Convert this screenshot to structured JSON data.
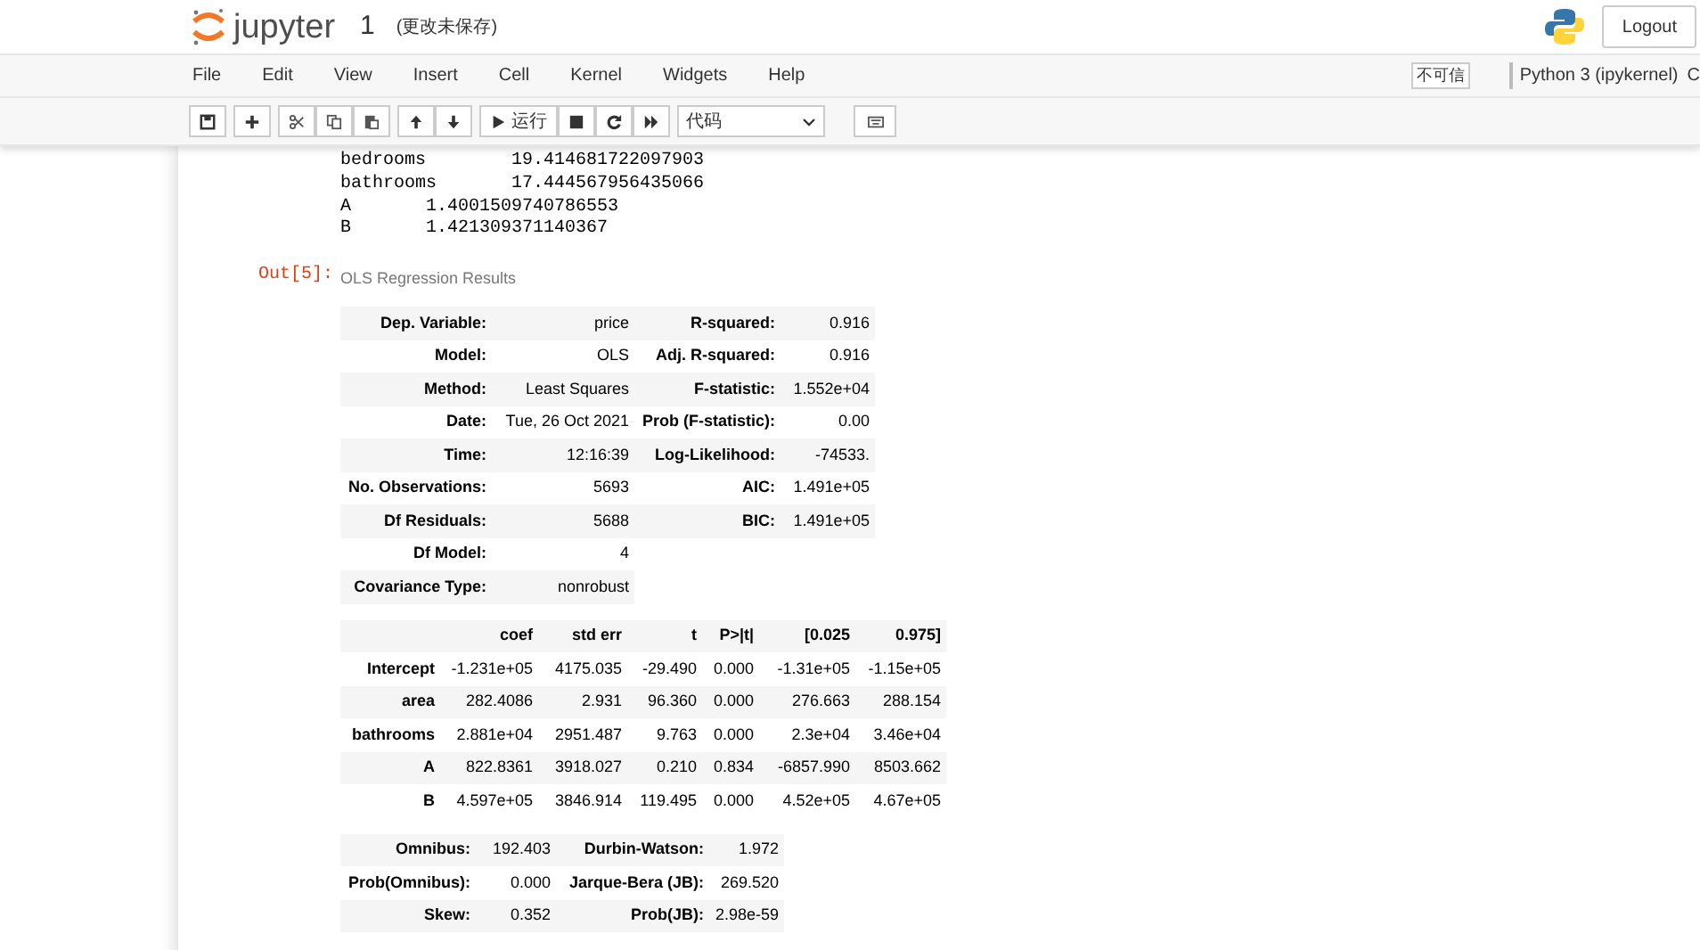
{
  "header": {
    "logo_text": "jupyter",
    "notebook_name": "1",
    "save_status": "(更改未保存)",
    "logout": "Logout"
  },
  "menu": [
    "File",
    "Edit",
    "View",
    "Insert",
    "Cell",
    "Kernel",
    "Widgets",
    "Help"
  ],
  "trust_indicator": "不可信",
  "kernel_name": "Python 3 (ipykernel)",
  "kernel_status_cut": "C",
  "toolbar": {
    "run_label": "运行",
    "cell_type": "代码"
  },
  "stdout_lines": [
    "bedrooms        19.414681722097903",
    "bathrooms       17.444567956435066",
    "A       1.4001509740786553",
    "B       1.421309371140367"
  ],
  "output_prompt": "Out[5]:",
  "caption": "OLS Regression Results",
  "summary_table": [
    [
      "Dep. Variable:",
      "price",
      "R-squared:",
      "0.916"
    ],
    [
      "Model:",
      "OLS",
      "Adj. R-squared:",
      "0.916"
    ],
    [
      "Method:",
      "Least Squares",
      "F-statistic:",
      "1.552e+04"
    ],
    [
      "Date:",
      "Tue, 26 Oct 2021",
      "Prob (F-statistic):",
      "0.00"
    ],
    [
      "Time:",
      "12:16:39",
      "Log-Likelihood:",
      "-74533."
    ],
    [
      "No. Observations:",
      "5693",
      "AIC:",
      "1.491e+05"
    ],
    [
      "Df Residuals:",
      "5688",
      "BIC:",
      "1.491e+05"
    ],
    [
      "Df Model:",
      "4"
    ],
    [
      "Covariance Type:",
      "nonrobust"
    ]
  ],
  "coef_table": {
    "columns": [
      "",
      "coef",
      "std err",
      "t",
      "P>|t|",
      "[0.025",
      "0.975]"
    ],
    "rows": [
      [
        "Intercept",
        "-1.231e+05",
        "4175.035",
        "-29.490",
        "0.000",
        "-1.31e+05",
        "-1.15e+05"
      ],
      [
        "area",
        "282.4086",
        "2.931",
        "96.360",
        "0.000",
        "276.663",
        "288.154"
      ],
      [
        "bathrooms",
        "2.881e+04",
        "2951.487",
        "9.763",
        "0.000",
        "2.3e+04",
        "3.46e+04"
      ],
      [
        "A",
        "822.8361",
        "3918.027",
        "0.210",
        "0.834",
        "-6857.990",
        "8503.662"
      ],
      [
        "B",
        "4.597e+05",
        "3846.914",
        "119.495",
        "0.000",
        "4.52e+05",
        "4.67e+05"
      ]
    ]
  },
  "diagnostics_table": [
    [
      "Omnibus:",
      "192.403",
      "Durbin-Watson:",
      "1.972"
    ],
    [
      "Prob(Omnibus):",
      "0.000",
      "Jarque-Bera (JB):",
      "269.520"
    ],
    [
      "Skew:",
      "0.352",
      "Prob(JB):",
      "2.98e-59"
    ]
  ]
}
